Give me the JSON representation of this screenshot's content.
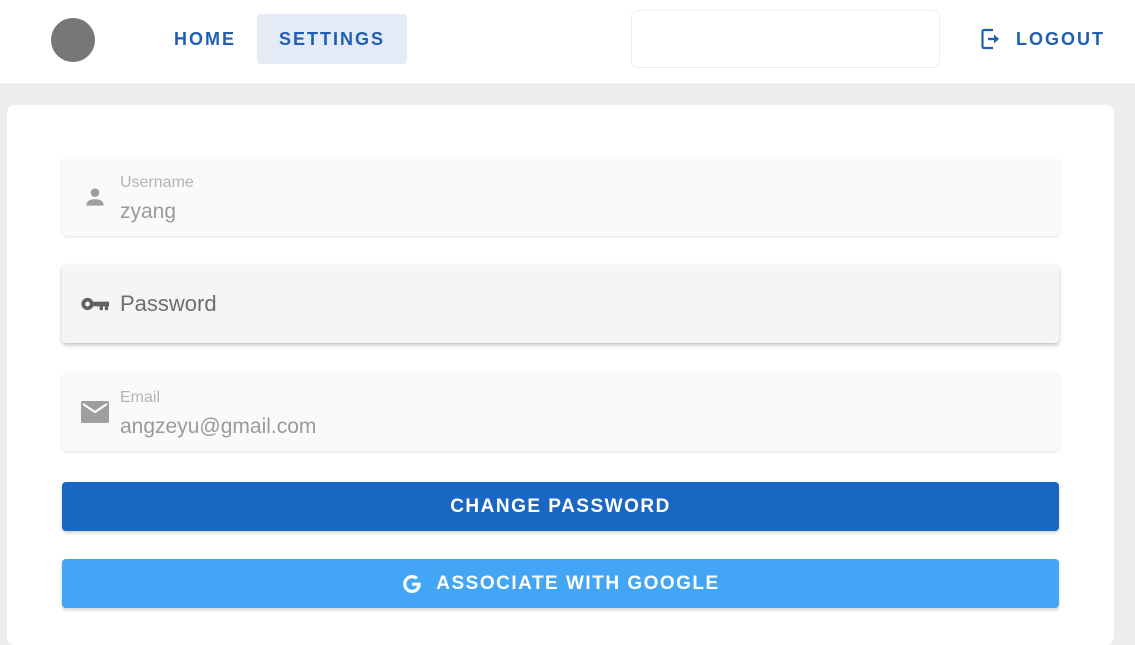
{
  "colors": {
    "primary": "#1a67c3",
    "secondary": "#42a5f5",
    "nav_text": "#1c5fb4",
    "nav_active_bg": "#e4eaf6",
    "page_bg": "#ededed"
  },
  "header": {
    "avatar_icon": "avatar-circle",
    "nav": {
      "home_label": "HOME",
      "settings_label": "SETTINGS",
      "active": "SETTINGS"
    },
    "search": {
      "value": ""
    },
    "logout_label": "LOGOUT",
    "logout_icon": "logout-icon"
  },
  "form": {
    "username": {
      "label": "Username",
      "value": "zyang",
      "icon": "person-icon"
    },
    "password": {
      "placeholder": "Password",
      "icon": "key-icon"
    },
    "email": {
      "label": "Email",
      "value": "angzeyu@gmail.com",
      "icon": "mail-icon"
    },
    "change_password_label": "CHANGE PASSWORD",
    "associate_google_label": "ASSOCIATE WITH GOOGLE",
    "google_icon": "google-icon"
  }
}
